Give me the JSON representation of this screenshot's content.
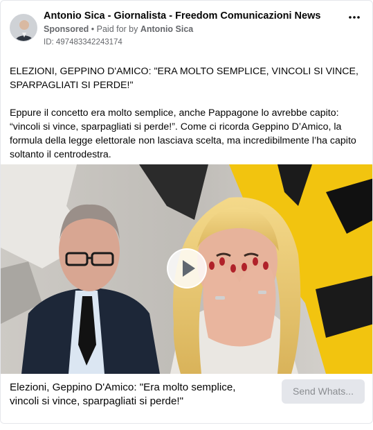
{
  "post": {
    "page_name": "Antonio Sica - Giornalista - Freedom Comunicazioni News",
    "sponsored_label": "Sponsored",
    "separator": " • ",
    "paid_for_prefix": "Paid for by ",
    "paid_for_name": "Antonio Sica",
    "ad_id": "ID: 497483342243174",
    "more_icon": "more-options-icon",
    "headline_text": "ELEZIONI, GEPPINO D'AMICO: \"ERA MOLTO SEMPLICE, VINCOLI SI VINCE, SPARPAGLIATI SI PERDE!\"",
    "paragraph_text": "Eppure il concetto era molto semplice, anche Pappagone lo avrebbe capito: “vincoli si vince, sparpagliati si perde!”. Come ci ricorda Geppino D’Amico, la formula della legge elettorale non lasciava scelta, ma incredibilmente l’ha capito soltanto il centrodestra."
  },
  "media": {
    "type": "video",
    "play_icon": "play-icon"
  },
  "footer": {
    "title": "Elezioni, Geppino D'Amico: \"Era molto semplice, vincoli si vince, sparpagliati si perde!\"",
    "cta_label": "Send Whats..."
  },
  "colors": {
    "meta_text": "#65676b",
    "cta_bg": "#e4e6eb",
    "border": "#e4e6eb",
    "accent_yellow": "#f2c40f"
  }
}
